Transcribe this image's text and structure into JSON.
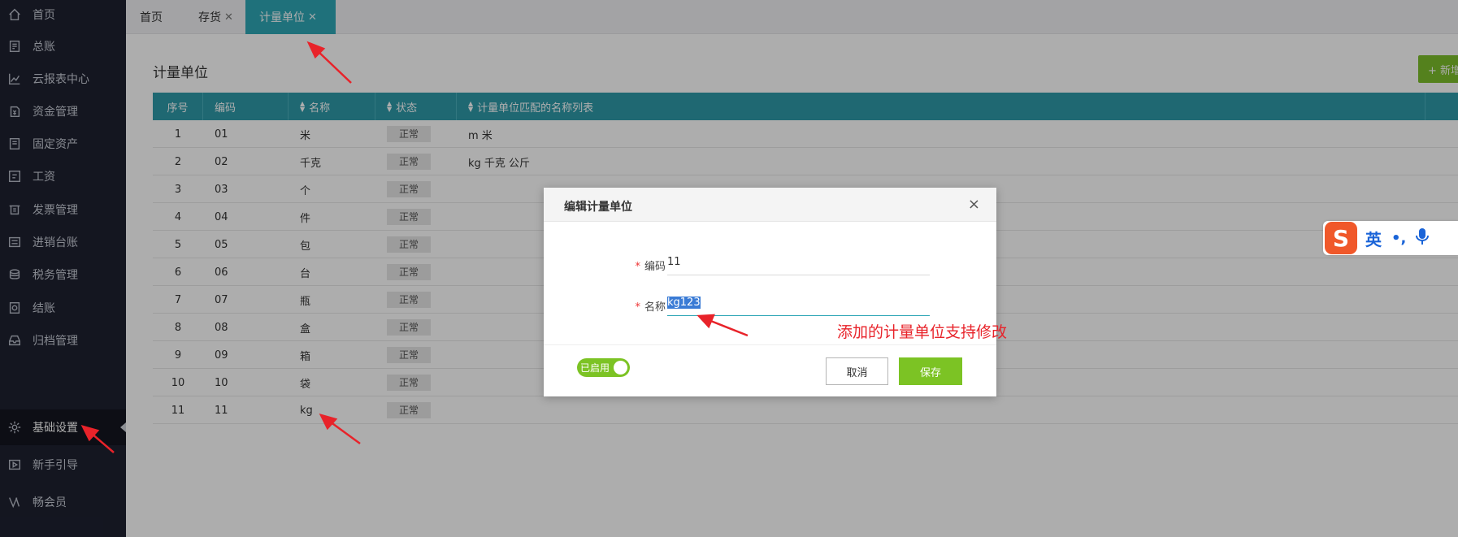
{
  "sidebar": {
    "items": [
      {
        "label": "首页",
        "icon": "home-icon"
      },
      {
        "label": "总账",
        "icon": "ledger-icon"
      },
      {
        "label": "云报表中心",
        "icon": "chart-icon"
      },
      {
        "label": "资金管理",
        "icon": "money-icon"
      },
      {
        "label": "固定资产",
        "icon": "asset-icon"
      },
      {
        "label": "工资",
        "icon": "salary-icon"
      },
      {
        "label": "发票管理",
        "icon": "invoice-icon"
      },
      {
        "label": "进销台账",
        "icon": "inventory-icon"
      },
      {
        "label": "税务管理",
        "icon": "tax-icon"
      },
      {
        "label": "结账",
        "icon": "close-books-icon"
      },
      {
        "label": "归档管理",
        "icon": "archive-icon"
      },
      {
        "label": "基础设置",
        "icon": "gear-icon"
      },
      {
        "label": "新手引导",
        "icon": "guide-icon"
      },
      {
        "label": "畅会员",
        "icon": "vip-icon"
      }
    ],
    "active_index": 11
  },
  "tabs": [
    {
      "label": "首页",
      "closable": false
    },
    {
      "label": "存货",
      "closable": true
    },
    {
      "label": "计量单位",
      "closable": true,
      "active": true
    }
  ],
  "page": {
    "title": "计量单位",
    "add_label": "+ 新增"
  },
  "table": {
    "headers": [
      "序号",
      "编码",
      "名称",
      "状态",
      "计量单位匹配的名称列表"
    ],
    "rows": [
      {
        "no": "1",
        "code": "01",
        "name": "米",
        "status": "正常",
        "aliases": "m 米"
      },
      {
        "no": "2",
        "code": "02",
        "name": "千克",
        "status": "正常",
        "aliases": "kg 千克 公斤"
      },
      {
        "no": "3",
        "code": "03",
        "name": "个",
        "status": "正常",
        "aliases": ""
      },
      {
        "no": "4",
        "code": "04",
        "name": "件",
        "status": "正常",
        "aliases": ""
      },
      {
        "no": "5",
        "code": "05",
        "name": "包",
        "status": "正常",
        "aliases": ""
      },
      {
        "no": "6",
        "code": "06",
        "name": "台",
        "status": "正常",
        "aliases": ""
      },
      {
        "no": "7",
        "code": "07",
        "name": "瓶",
        "status": "正常",
        "aliases": ""
      },
      {
        "no": "8",
        "code": "08",
        "name": "盒",
        "status": "正常",
        "aliases": ""
      },
      {
        "no": "9",
        "code": "09",
        "name": "箱",
        "status": "正常",
        "aliases": ""
      },
      {
        "no": "10",
        "code": "10",
        "name": "袋",
        "status": "正常",
        "aliases": ""
      },
      {
        "no": "11",
        "code": "11",
        "name": "kg",
        "status": "正常",
        "aliases": ""
      }
    ]
  },
  "dialog": {
    "title": "编辑计量单位",
    "close_glyph": "×",
    "code_label": "编码",
    "code_value": "11",
    "name_label": "名称",
    "name_value": "kg123",
    "required_mark": "*",
    "toggle_label": "已启用",
    "cancel_label": "取消",
    "save_label": "保存"
  },
  "annotation": {
    "text": "添加的计量单位支持修改",
    "color": "#e8232a"
  },
  "ime": {
    "logo": "S",
    "mode": "英",
    "punct": "•,"
  },
  "colors": {
    "sidebar_bg": "#1e2130",
    "accent_teal": "#2fa7b6",
    "button_green": "#7cc324"
  }
}
